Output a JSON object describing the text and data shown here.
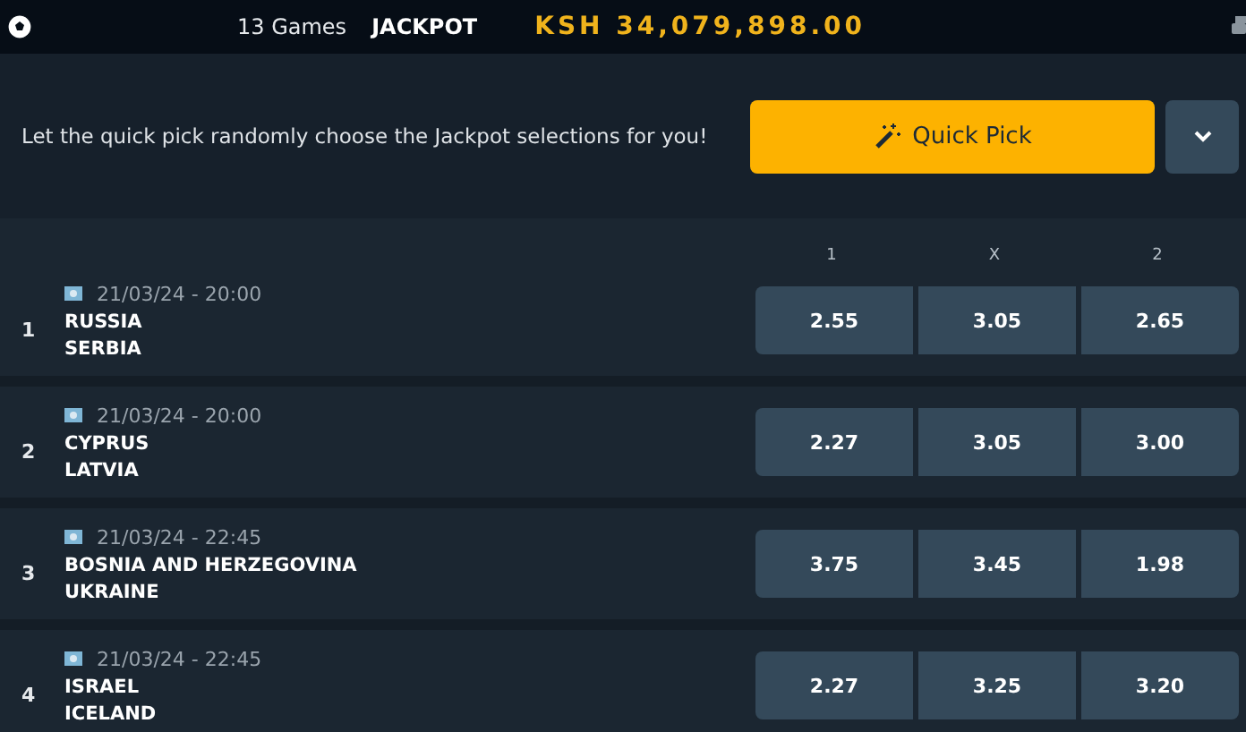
{
  "header": {
    "games": "13 Games",
    "title": "JACKPOT",
    "amount": "KSH 34,079,898.00"
  },
  "quick_pick": {
    "text": "Let the quick pick randomly choose the Jackpot selections for you!",
    "button": "Quick Pick"
  },
  "table": {
    "columns": [
      "1",
      "X",
      "2"
    ],
    "rows": [
      {
        "number": "1",
        "time": "21/03/24 - 20:00",
        "home": "RUSSIA",
        "away": "SERBIA",
        "odds": [
          "2.55",
          "3.05",
          "2.65"
        ]
      },
      {
        "number": "2",
        "time": "21/03/24 - 20:00",
        "home": "CYPRUS",
        "away": "LATVIA",
        "odds": [
          "2.27",
          "3.05",
          "3.00"
        ]
      },
      {
        "number": "3",
        "time": "21/03/24 - 22:45",
        "home": "BOSNIA AND HERZEGOVINA",
        "away": "UKRAINE",
        "odds": [
          "3.75",
          "3.45",
          "1.98"
        ]
      },
      {
        "number": "4",
        "time": "21/03/24 - 22:45",
        "home": "ISRAEL",
        "away": "ICELAND",
        "odds": [
          "2.27",
          "3.25",
          "3.20"
        ]
      }
    ]
  }
}
